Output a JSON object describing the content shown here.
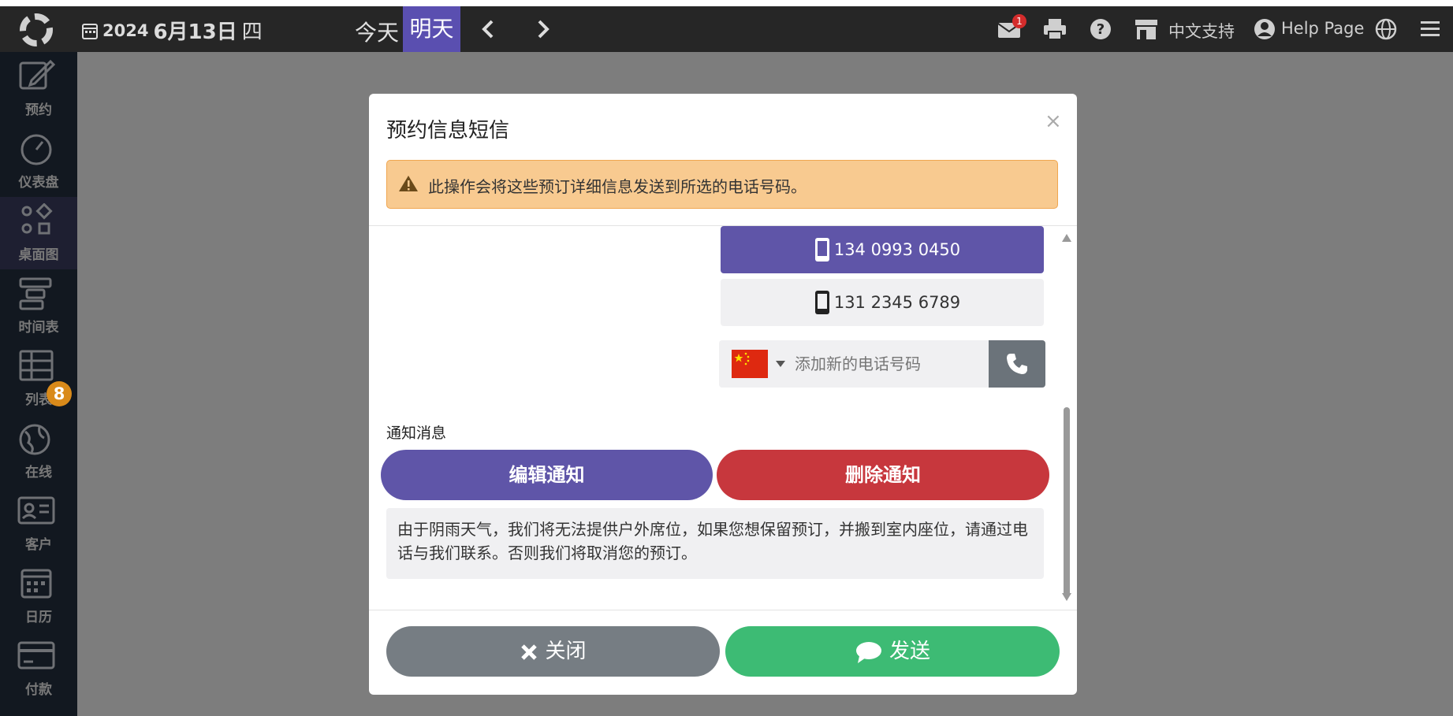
{
  "topbar": {
    "year": "2024",
    "month_day": "6月13日",
    "weekday": "四",
    "today_label": "今天",
    "tomorrow_label": "明天",
    "mail_badge": "1",
    "support_label": "中文支持",
    "help_label": "Help Page"
  },
  "sidebar": {
    "items": [
      {
        "label": "预约",
        "icon": "edit-icon"
      },
      {
        "label": "仪表盘",
        "icon": "dashboard-icon"
      },
      {
        "label": "桌面图",
        "icon": "floorplan-icon"
      },
      {
        "label": "时间表",
        "icon": "timeline-icon"
      },
      {
        "label": "列表",
        "icon": "list-icon"
      },
      {
        "label": "在线",
        "icon": "globe-icon"
      },
      {
        "label": "客户",
        "icon": "contact-card-icon"
      },
      {
        "label": "日历",
        "icon": "calendar-icon"
      },
      {
        "label": "付款",
        "icon": "credit-card-icon"
      }
    ],
    "online_badge": "8"
  },
  "modal": {
    "title": "预约信息短信",
    "close_symbol": "×",
    "alert_text": "此操作会将这些预订详细信息发送到所选的电话号码。",
    "phones": [
      {
        "number": "134 0993 0450",
        "selected": true
      },
      {
        "number": "131 2345 6789",
        "selected": false
      }
    ],
    "add_phone_placeholder": "添加新的电话号码",
    "notification_label": "通知消息",
    "edit_notification": "编辑通知",
    "delete_notification": "删除通知",
    "message": "由于阴雨天气，我们将无法提供户外席位，如果您想保留预订，并搬到室内座位，请通过电话与我们联系。否则我们将取消您的预订。",
    "close_button": "关闭",
    "send_button": "发送"
  },
  "colors": {
    "topbar": "#262626",
    "sidebar": "#253040",
    "accent_purple": "#5f55a8",
    "danger": "#c7373d",
    "send_green": "#3dbb74",
    "close_gray": "#767d83",
    "alert_bg": "#f8ca90"
  }
}
